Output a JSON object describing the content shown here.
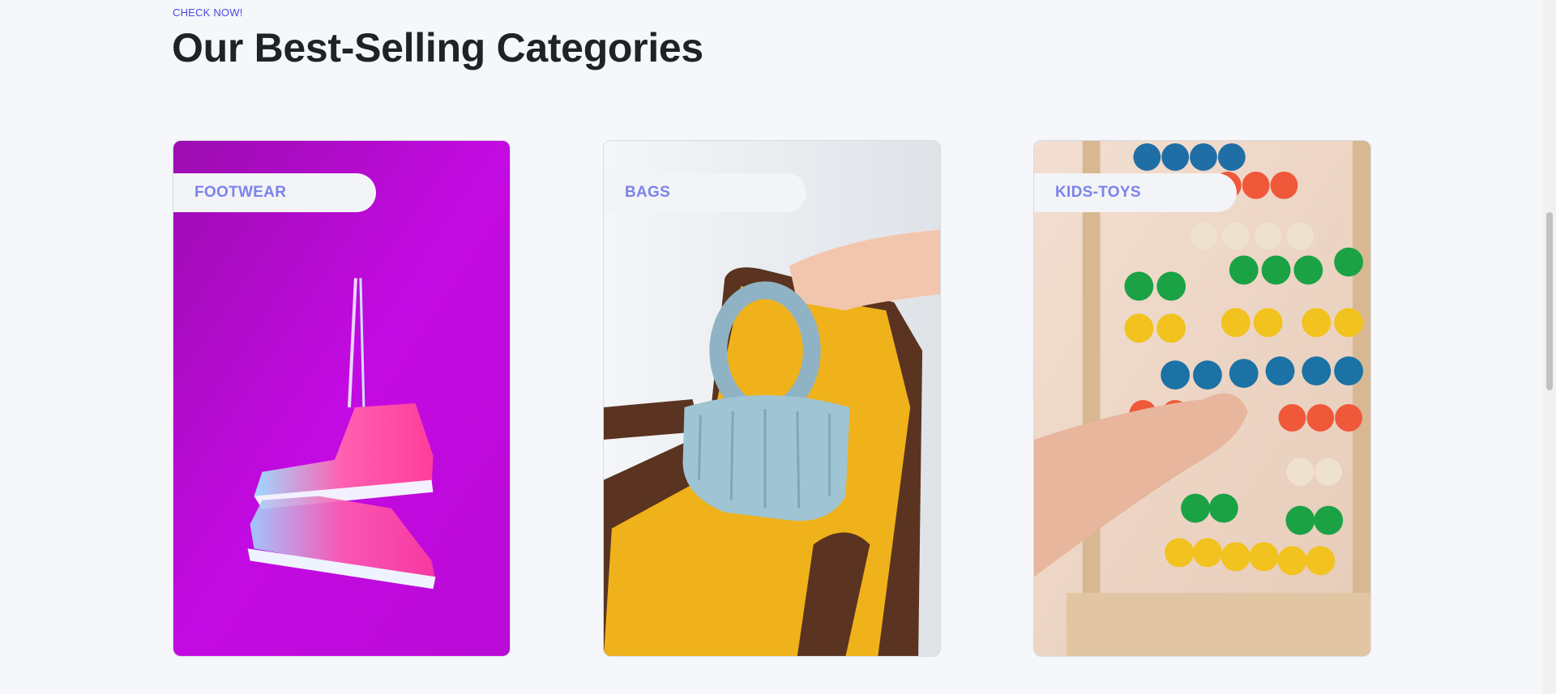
{
  "section": {
    "eyebrow": "CHECK NOW!",
    "title": "Our Best-Selling Categories"
  },
  "categories": [
    {
      "label": "FOOTWEAR",
      "image": "hanging-sneakers-on-magenta-background",
      "accent": "#c40ee0"
    },
    {
      "label": "BAGS",
      "image": "blue-handbag-held-over-yellow-chair",
      "accent": "#f2b21a"
    },
    {
      "label": "KIDS-TOYS",
      "image": "colorful-abacus-with-child-hand",
      "accent": "#e8d4c3"
    }
  ],
  "colors": {
    "background": "#f5f7fa",
    "eyebrow": "#4f46e5",
    "title": "#1f2226",
    "pill_text": "#7b83eb",
    "pill_bg": "#f3f4f7"
  }
}
